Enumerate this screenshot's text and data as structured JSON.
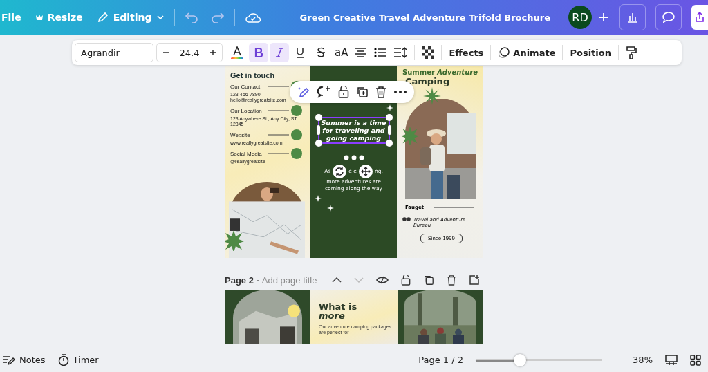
{
  "top_bar": {
    "menu": "File",
    "resize": "Resize",
    "mode": "Editing",
    "title": "Green Creative Travel Adventure Trifold Brochure",
    "avatar": "RD"
  },
  "text_toolbar": {
    "font": "Agrandir",
    "size": "24.4",
    "bold": true,
    "italic": true,
    "underline": false,
    "strikethrough": false,
    "case": "aA",
    "effects": "Effects",
    "animate": "Animate",
    "position": "Position"
  },
  "page1": {
    "left": {
      "heading": "Get in touch",
      "contacts": [
        {
          "label": "Our Contact",
          "lines": [
            "123-456-7890",
            "hello@reallygreatsite.com"
          ]
        },
        {
          "label": "Our Location",
          "lines": [
            "123 Anywhere St., Any City, ST 12345"
          ]
        },
        {
          "label": "Website",
          "lines": [
            "www.reallygreatsite.com"
          ]
        },
        {
          "label": "Social Media",
          "lines": [
            "@reallygreatsite"
          ]
        }
      ]
    },
    "middle": {
      "quote": "Summer is a time for traveling and going camping",
      "body_fragments": [
        "As",
        "e e",
        "ng,"
      ],
      "body_lines": [
        "more adventures are",
        "coming along the way"
      ]
    },
    "right": {
      "title": "Summer *Adventure*",
      "title_line2": "Camping",
      "brand": "Fauget",
      "bureau": "Travel and Adventure Bureau",
      "badge": "Since 1999"
    }
  },
  "page2": {
    "label": "Page 2 -",
    "title_placeholder": "Add page title",
    "heading": "What is",
    "heading_italic": "more",
    "body": "Our adventure camping packages are perfect for"
  },
  "bottom_bar": {
    "notes": "Notes",
    "timer": "Timer",
    "page": "Page 1 / 2",
    "zoom": {
      "level": 0.35,
      "reading": "38%"
    }
  }
}
